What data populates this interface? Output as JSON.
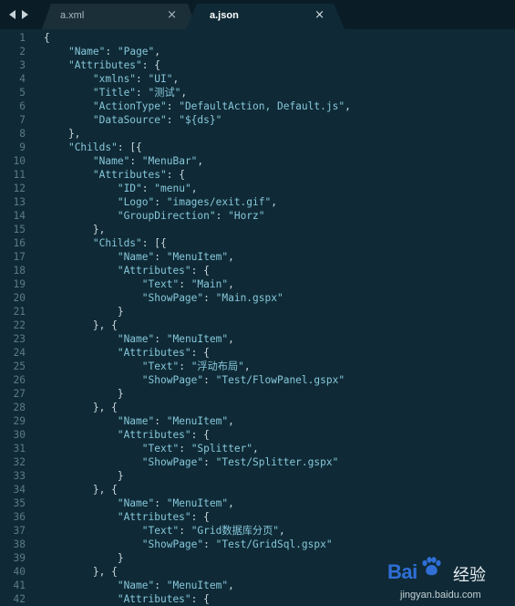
{
  "tabs": [
    {
      "label": "a.xml",
      "active": false,
      "close": "×"
    },
    {
      "label": "a.json",
      "active": true,
      "close": "×"
    }
  ],
  "nav": {
    "back_icon": "triangle-left",
    "forward_icon": "triangle-right"
  },
  "colors": {
    "background": "#0f2a36",
    "tabbar": "#0a1d26",
    "string": "#86c7da",
    "punctuation": "#c9d5da",
    "line_number": "#5c7a88"
  },
  "code_lines": [
    {
      "n": "1",
      "tokens": [
        [
          "p",
          "{"
        ]
      ]
    },
    {
      "n": "2",
      "tokens": [
        [
          "p",
          "    "
        ],
        [
          "s",
          "\"Name\""
        ],
        [
          "p",
          ": "
        ],
        [
          "s",
          "\"Page\""
        ],
        [
          "p",
          ","
        ]
      ]
    },
    {
      "n": "3",
      "tokens": [
        [
          "p",
          "    "
        ],
        [
          "s",
          "\"Attributes\""
        ],
        [
          "p",
          ": {"
        ]
      ]
    },
    {
      "n": "4",
      "tokens": [
        [
          "p",
          "        "
        ],
        [
          "s",
          "\"xmlns\""
        ],
        [
          "p",
          ": "
        ],
        [
          "s",
          "\"UI\""
        ],
        [
          "p",
          ","
        ]
      ]
    },
    {
      "n": "5",
      "tokens": [
        [
          "p",
          "        "
        ],
        [
          "s",
          "\"Title\""
        ],
        [
          "p",
          ": "
        ],
        [
          "s",
          "\"测试\""
        ],
        [
          "p",
          ","
        ]
      ]
    },
    {
      "n": "6",
      "tokens": [
        [
          "p",
          "        "
        ],
        [
          "s",
          "\"ActionType\""
        ],
        [
          "p",
          ": "
        ],
        [
          "s",
          "\"DefaultAction, Default.js\""
        ],
        [
          "p",
          ","
        ]
      ]
    },
    {
      "n": "7",
      "tokens": [
        [
          "p",
          "        "
        ],
        [
          "s",
          "\"DataSource\""
        ],
        [
          "p",
          ": "
        ],
        [
          "s",
          "\"${ds}\""
        ]
      ]
    },
    {
      "n": "8",
      "tokens": [
        [
          "p",
          "    },"
        ]
      ]
    },
    {
      "n": "9",
      "tokens": [
        [
          "p",
          "    "
        ],
        [
          "s",
          "\"Childs\""
        ],
        [
          "p",
          ": [{"
        ]
      ]
    },
    {
      "n": "10",
      "tokens": [
        [
          "p",
          "        "
        ],
        [
          "s",
          "\"Name\""
        ],
        [
          "p",
          ": "
        ],
        [
          "s",
          "\"MenuBar\""
        ],
        [
          "p",
          ","
        ]
      ]
    },
    {
      "n": "11",
      "tokens": [
        [
          "p",
          "        "
        ],
        [
          "s",
          "\"Attributes\""
        ],
        [
          "p",
          ": {"
        ]
      ]
    },
    {
      "n": "12",
      "tokens": [
        [
          "p",
          "            "
        ],
        [
          "s",
          "\"ID\""
        ],
        [
          "p",
          ": "
        ],
        [
          "s",
          "\"menu\""
        ],
        [
          "p",
          ","
        ]
      ]
    },
    {
      "n": "13",
      "tokens": [
        [
          "p",
          "            "
        ],
        [
          "s",
          "\"Logo\""
        ],
        [
          "p",
          ": "
        ],
        [
          "s",
          "\"images/exit.gif\""
        ],
        [
          "p",
          ","
        ]
      ]
    },
    {
      "n": "14",
      "tokens": [
        [
          "p",
          "            "
        ],
        [
          "s",
          "\"GroupDirection\""
        ],
        [
          "p",
          ": "
        ],
        [
          "s",
          "\"Horz\""
        ]
      ]
    },
    {
      "n": "15",
      "tokens": [
        [
          "p",
          "        },"
        ]
      ]
    },
    {
      "n": "16",
      "tokens": [
        [
          "p",
          "        "
        ],
        [
          "s",
          "\"Childs\""
        ],
        [
          "p",
          ": [{"
        ]
      ]
    },
    {
      "n": "17",
      "tokens": [
        [
          "p",
          "            "
        ],
        [
          "s",
          "\"Name\""
        ],
        [
          "p",
          ": "
        ],
        [
          "s",
          "\"MenuItem\""
        ],
        [
          "p",
          ","
        ]
      ]
    },
    {
      "n": "18",
      "tokens": [
        [
          "p",
          "            "
        ],
        [
          "s",
          "\"Attributes\""
        ],
        [
          "p",
          ": {"
        ]
      ]
    },
    {
      "n": "19",
      "tokens": [
        [
          "p",
          "                "
        ],
        [
          "s",
          "\"Text\""
        ],
        [
          "p",
          ": "
        ],
        [
          "s",
          "\"Main\""
        ],
        [
          "p",
          ","
        ]
      ]
    },
    {
      "n": "20",
      "tokens": [
        [
          "p",
          "                "
        ],
        [
          "s",
          "\"ShowPage\""
        ],
        [
          "p",
          ": "
        ],
        [
          "s",
          "\"Main.gspx\""
        ]
      ]
    },
    {
      "n": "21",
      "tokens": [
        [
          "p",
          "            }"
        ]
      ]
    },
    {
      "n": "22",
      "tokens": [
        [
          "p",
          "        }, {"
        ]
      ]
    },
    {
      "n": "23",
      "tokens": [
        [
          "p",
          "            "
        ],
        [
          "s",
          "\"Name\""
        ],
        [
          "p",
          ": "
        ],
        [
          "s",
          "\"MenuItem\""
        ],
        [
          "p",
          ","
        ]
      ]
    },
    {
      "n": "24",
      "tokens": [
        [
          "p",
          "            "
        ],
        [
          "s",
          "\"Attributes\""
        ],
        [
          "p",
          ": {"
        ]
      ]
    },
    {
      "n": "25",
      "tokens": [
        [
          "p",
          "                "
        ],
        [
          "s",
          "\"Text\""
        ],
        [
          "p",
          ": "
        ],
        [
          "s",
          "\"浮动布局\""
        ],
        [
          "p",
          ","
        ]
      ]
    },
    {
      "n": "26",
      "tokens": [
        [
          "p",
          "                "
        ],
        [
          "s",
          "\"ShowPage\""
        ],
        [
          "p",
          ": "
        ],
        [
          "s",
          "\"Test/FlowPanel.gspx\""
        ]
      ]
    },
    {
      "n": "27",
      "tokens": [
        [
          "p",
          "            }"
        ]
      ]
    },
    {
      "n": "28",
      "tokens": [
        [
          "p",
          "        }, {"
        ]
      ]
    },
    {
      "n": "29",
      "tokens": [
        [
          "p",
          "            "
        ],
        [
          "s",
          "\"Name\""
        ],
        [
          "p",
          ": "
        ],
        [
          "s",
          "\"MenuItem\""
        ],
        [
          "p",
          ","
        ]
      ]
    },
    {
      "n": "30",
      "tokens": [
        [
          "p",
          "            "
        ],
        [
          "s",
          "\"Attributes\""
        ],
        [
          "p",
          ": {"
        ]
      ]
    },
    {
      "n": "31",
      "tokens": [
        [
          "p",
          "                "
        ],
        [
          "s",
          "\"Text\""
        ],
        [
          "p",
          ": "
        ],
        [
          "s",
          "\"Splitter\""
        ],
        [
          "p",
          ","
        ]
      ]
    },
    {
      "n": "32",
      "tokens": [
        [
          "p",
          "                "
        ],
        [
          "s",
          "\"ShowPage\""
        ],
        [
          "p",
          ": "
        ],
        [
          "s",
          "\"Test/Splitter.gspx\""
        ]
      ]
    },
    {
      "n": "33",
      "tokens": [
        [
          "p",
          "            }"
        ]
      ]
    },
    {
      "n": "34",
      "tokens": [
        [
          "p",
          "        }, {"
        ]
      ]
    },
    {
      "n": "35",
      "tokens": [
        [
          "p",
          "            "
        ],
        [
          "s",
          "\"Name\""
        ],
        [
          "p",
          ": "
        ],
        [
          "s",
          "\"MenuItem\""
        ],
        [
          "p",
          ","
        ]
      ]
    },
    {
      "n": "36",
      "tokens": [
        [
          "p",
          "            "
        ],
        [
          "s",
          "\"Attributes\""
        ],
        [
          "p",
          ": {"
        ]
      ]
    },
    {
      "n": "37",
      "tokens": [
        [
          "p",
          "                "
        ],
        [
          "s",
          "\"Text\""
        ],
        [
          "p",
          ": "
        ],
        [
          "s",
          "\"Grid数据库分页\""
        ],
        [
          "p",
          ","
        ]
      ]
    },
    {
      "n": "38",
      "tokens": [
        [
          "p",
          "                "
        ],
        [
          "s",
          "\"ShowPage\""
        ],
        [
          "p",
          ": "
        ],
        [
          "s",
          "\"Test/GridSql.gspx\""
        ]
      ]
    },
    {
      "n": "39",
      "tokens": [
        [
          "p",
          "            }"
        ]
      ]
    },
    {
      "n": "40",
      "tokens": [
        [
          "p",
          "        }, {"
        ]
      ]
    },
    {
      "n": "41",
      "tokens": [
        [
          "p",
          "            "
        ],
        [
          "s",
          "\"Name\""
        ],
        [
          "p",
          ": "
        ],
        [
          "s",
          "\"MenuItem\""
        ],
        [
          "p",
          ","
        ]
      ]
    },
    {
      "n": "42",
      "tokens": [
        [
          "p",
          "            "
        ],
        [
          "s",
          "\"Attributes\""
        ],
        [
          "p",
          ": {"
        ]
      ]
    }
  ],
  "watermark": {
    "logo": "Bai",
    "logo_suffix": "经验",
    "url": "jingyan.baidu.com"
  }
}
